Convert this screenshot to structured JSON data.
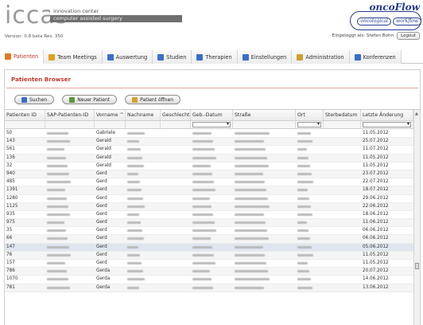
{
  "header": {
    "logo": "iccas",
    "logo_line1": "innovation center",
    "logo_line2": "computer assisted surgery",
    "version": "Version: 0.8 beta Rev. 350",
    "onco_brand": "oncoFlow",
    "onco_pill_left": "oncological",
    "onco_pill_right": "workflow",
    "login_text": "Eingeloggt als: Stefan Bohn",
    "logout_label": "Logout"
  },
  "tabs": [
    {
      "label": "Patienten",
      "icon": "person-icon",
      "color": "#e07b20"
    },
    {
      "label": "Team Meetings",
      "icon": "meeting-icon",
      "color": "#e0a020"
    },
    {
      "label": "Auswertung",
      "icon": "chart-icon",
      "color": "#3a6fc9"
    },
    {
      "label": "Studien",
      "icon": "study-icon",
      "color": "#3a6fc9"
    },
    {
      "label": "Therapien",
      "icon": "check-icon",
      "color": "#3a6fc9"
    },
    {
      "label": "Einstellungen",
      "icon": "list-icon",
      "color": "#3a6fc9"
    },
    {
      "label": "Administration",
      "icon": "admin-icon",
      "color": "#d0a030"
    },
    {
      "label": "Konferenzen",
      "icon": "conference-icon",
      "color": "#3a6fc9"
    }
  ],
  "panel": {
    "title": "Patienten Browser",
    "buttons": {
      "search": "Suchen",
      "new_patient": "Neuer Patient",
      "open_patient": "Patient öffnen"
    }
  },
  "grid": {
    "columns": [
      "Patienten ID",
      "SAP-Patienten-ID",
      "Vorname ^",
      "Nachname",
      "Geschlecht",
      "Geb.-Datum",
      "Straße",
      "Ort",
      "Sterbedatum",
      "Letzte Änderung"
    ],
    "rows": [
      {
        "id": "50",
        "vorname": "Gabriele",
        "date": "11.05.2012"
      },
      {
        "id": "143",
        "vorname": "Gerald",
        "date": "25.07.2012"
      },
      {
        "id": "561",
        "vorname": "Gerald",
        "date": "11.07.2012"
      },
      {
        "id": "136",
        "vorname": "Gerald",
        "date": "11.05.2012"
      },
      {
        "id": "32",
        "vorname": "Gerald",
        "date": "11.05.2012"
      },
      {
        "id": "940",
        "vorname": "Gerd",
        "date": "23.07.2012"
      },
      {
        "id": "485",
        "vorname": "Gerd",
        "date": "22.07.2012"
      },
      {
        "id": "1391",
        "vorname": "Gerd",
        "date": "18.07.2012"
      },
      {
        "id": "1280",
        "vorname": "Gerd",
        "date": "29.06.2012"
      },
      {
        "id": "1125",
        "vorname": "Gerd",
        "date": "22.06.2012"
      },
      {
        "id": "935",
        "vorname": "Gerd",
        "date": "18.06.2012"
      },
      {
        "id": "975",
        "vorname": "Gerd",
        "date": "11.06.2012"
      },
      {
        "id": "35",
        "vorname": "Gerd",
        "date": "06.06.2012"
      },
      {
        "id": "66",
        "vorname": "Gerd",
        "date": "06.06.2012"
      },
      {
        "id": "147",
        "vorname": "Gerd",
        "date": "05.06.2012"
      },
      {
        "id": "76",
        "vorname": "Gerd",
        "date": "11.05.2012"
      },
      {
        "id": "157",
        "vorname": "Gerd",
        "date": "11.05.2012"
      },
      {
        "id": "786",
        "vorname": "Gerda",
        "date": "20.07.2012"
      },
      {
        "id": "1070",
        "vorname": "Gerda",
        "date": "14.06.2012"
      },
      {
        "id": "781",
        "vorname": "Gerda",
        "date": "13.06.2012"
      }
    ]
  },
  "colors": {
    "accent": "#c0392b",
    "brand_blue": "#233c8f",
    "selected_row": "#dfe6ef"
  }
}
